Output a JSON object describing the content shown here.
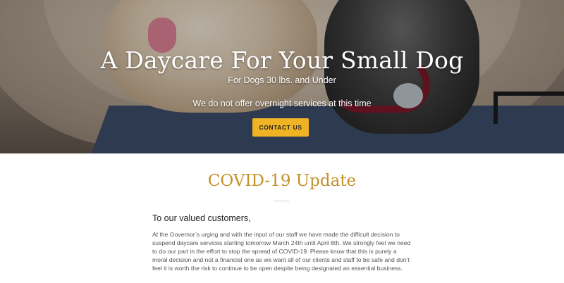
{
  "hero": {
    "title": "A Daycare For Your Small Dog",
    "subtitle": "For Dogs 30 lbs. and Under",
    "note": "We do not offer overnight services at this time",
    "cta_label": "CONTACT US"
  },
  "update": {
    "title": "COVID-19 Update",
    "greeting": "To our valued customers,",
    "body": "At the Governor’s urging and with the input of our staff we have made the difficult decision to suspend daycare services starting tomorrow March 24th until April 8th.  We strongly feel we need to do our part in the effort to stop the spread of COVID-19.  Please know that this is purely a moral decision and not a financial one as we want all of our clients and staff to be safe and don’t feel it is worth the risk to continue to be open despite being designated an essential business."
  },
  "colors": {
    "accent": "#c2912a",
    "button": "#f0b323"
  }
}
